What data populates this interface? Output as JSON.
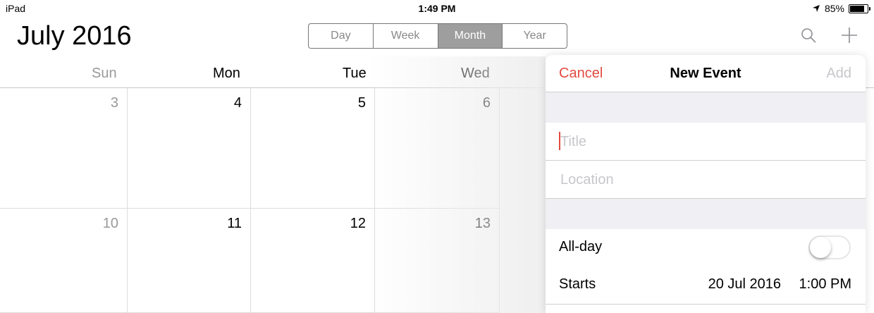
{
  "status_bar": {
    "device": "iPad",
    "time": "1:49 PM",
    "battery_text": "85%",
    "battery_level": 0.85
  },
  "header": {
    "month": "July",
    "year": "2016",
    "segments": [
      "Day",
      "Week",
      "Month",
      "Year"
    ],
    "selected_segment": "Month",
    "icons": [
      "search-icon",
      "plus-icon"
    ]
  },
  "calendar": {
    "weekdays": [
      "Sun",
      "Mon",
      "Tue",
      "Wed"
    ],
    "weeks": [
      [
        "3",
        "4",
        "5",
        "6"
      ],
      [
        "10",
        "11",
        "12",
        "13"
      ]
    ]
  },
  "new_event": {
    "cancel_label": "Cancel",
    "title": "New Event",
    "add_label": "Add",
    "title_placeholder": "Title",
    "location_placeholder": "Location",
    "allday_label": "All-day",
    "allday_on": false,
    "starts_label": "Starts",
    "starts_date": "20 Jul 2016",
    "starts_time": "1:00 PM"
  },
  "colors": {
    "accent_red": "#e24a3f",
    "disabled_gray": "#c7c7cc",
    "segment_selected": "#9e9e9e"
  }
}
